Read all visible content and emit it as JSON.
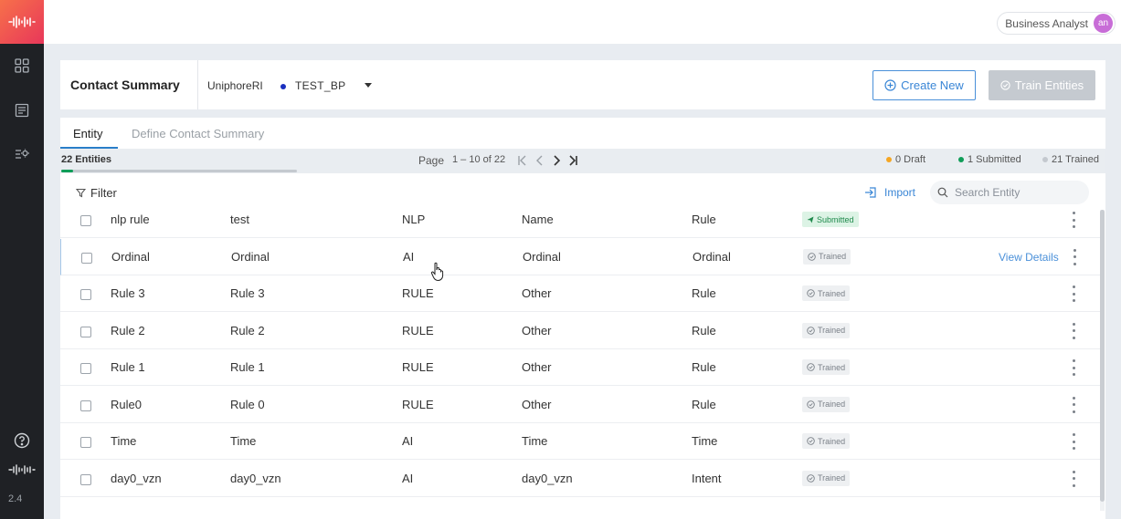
{
  "sidebar": {
    "logo_icon": "uniphore-wave-icon",
    "items": [
      {
        "icon": "dashboard-grid-icon"
      },
      {
        "icon": "document-list-icon"
      },
      {
        "icon": "settings-list-icon"
      }
    ],
    "help_icon": "help-circle-icon",
    "version": "2.4"
  },
  "topbar": {
    "user_name": "Business Analyst",
    "avatar_initials": "an",
    "avatar_color": "#c86dd7"
  },
  "header": {
    "title": "Contact Summary",
    "org": "UniphoreRI",
    "bp_name": "TEST_BP",
    "bp_dot_color": "#1a2fbf",
    "create_label": "Create New",
    "train_label": "Train Entities",
    "accent_color": "#3a86d6"
  },
  "tabs": [
    {
      "label": "Entity",
      "active": true
    },
    {
      "label": "Define Contact Summary",
      "active": false
    }
  ],
  "subbar": {
    "entity_count": "22 Entities",
    "progress": 0.05,
    "page_label": "Page",
    "page_range": "1 – 10 of 22",
    "legend": [
      {
        "label": "0 Draft",
        "color": "#f5a623"
      },
      {
        "label": "1 Submitted",
        "color": "#0f9d58"
      },
      {
        "label": "21 Trained",
        "color": "#c4c9cf"
      }
    ]
  },
  "toolbar": {
    "filter_label": "Filter",
    "import_label": "Import",
    "search_placeholder": "Search Entity"
  },
  "table": {
    "view_details_label": "View Details",
    "rows": [
      {
        "name": "nlp rule",
        "label": "test",
        "method": "NLP",
        "category": "Name",
        "type": "Rule",
        "status": "Submitted"
      },
      {
        "name": "Ordinal",
        "label": "Ordinal",
        "method": "AI",
        "category": "Ordinal",
        "type": "Ordinal",
        "status": "Trained"
      },
      {
        "name": "Rule 3",
        "label": "Rule 3",
        "method": "RULE",
        "category": "Other",
        "type": "Rule",
        "status": "Trained"
      },
      {
        "name": "Rule 2",
        "label": "Rule 2",
        "method": "RULE",
        "category": "Other",
        "type": "Rule",
        "status": "Trained"
      },
      {
        "name": "Rule 1",
        "label": "Rule 1",
        "method": "RULE",
        "category": "Other",
        "type": "Rule",
        "status": "Trained"
      },
      {
        "name": "Rule0",
        "label": "Rule 0",
        "method": "RULE",
        "category": "Other",
        "type": "Rule",
        "status": "Trained"
      },
      {
        "name": "Time",
        "label": "Time",
        "method": "AI",
        "category": "Time",
        "type": "Time",
        "status": "Trained"
      },
      {
        "name": "day0_vzn",
        "label": "day0_vzn",
        "method": "AI",
        "category": "day0_vzn",
        "type": "Intent",
        "status": "Trained"
      }
    ]
  }
}
